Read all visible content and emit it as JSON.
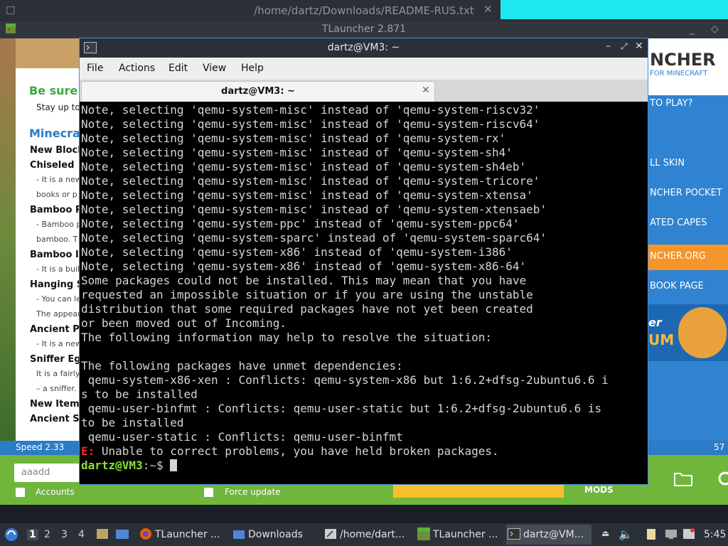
{
  "background_window": {
    "title": "/home/dartz/Downloads/README-RUS.txt"
  },
  "tlauncher": {
    "title": "TLauncher 2.871",
    "news_heading": "Be sure t",
    "news_sub": "Stay up to",
    "news_section": "Minecraft",
    "news_items": [
      {
        "text": "New Blocks",
        "style": "bold"
      },
      {
        "text": "Chiseled",
        "style": "bold"
      },
      {
        "text": "- It is a new",
        "style": "small"
      },
      {
        "text": "books or p",
        "style": "small"
      },
      {
        "text": "Bamboo P",
        "style": "bold"
      },
      {
        "text": "- Bamboo p",
        "style": "small"
      },
      {
        "text": "bamboo. T",
        "style": "small"
      },
      {
        "text": "Bamboo I",
        "style": "bold"
      },
      {
        "text": "- It is a buil",
        "style": "small"
      },
      {
        "text": "Hanging S",
        "style": "bold"
      },
      {
        "text": "- You can le",
        "style": "small"
      },
      {
        "text": "The appear",
        "style": "small"
      },
      {
        "text": "Ancient P",
        "style": "bold"
      },
      {
        "text": "- It is a new",
        "style": "small"
      },
      {
        "text": "Sniffer Eg",
        "style": "bold"
      },
      {
        "text": "It is a fairly",
        "style": "small"
      },
      {
        "text": "– a sniffer.",
        "style": "small"
      },
      {
        "text": "New Items",
        "style": "bold"
      },
      {
        "text": "Ancient S",
        "style": "bold"
      }
    ],
    "logo_text": "NCHER",
    "logo_sub": "FOR MINECRAFT",
    "right_menu": [
      "TO PLAY?",
      "LL SKIN",
      "NCHER POCKET",
      "ATED CAPES",
      "NCHER.ORG",
      "BOOK PAGE"
    ],
    "speed_label": "Speed 2.33",
    "progress_text": "57",
    "username_value": "aaadd",
    "accounts_label": "Accounts",
    "force_update_label": "Force update",
    "mods_label": "MODS",
    "colors": {
      "tl_green": "#6fb63b",
      "tl_blue": "#2f83d0",
      "tl_orange": "#f5952a"
    }
  },
  "terminal": {
    "window_title": "dartz@VM3: ~",
    "menu": [
      "File",
      "Actions",
      "Edit",
      "View",
      "Help"
    ],
    "tab_title": "dartz@VM3: ~",
    "lines": [
      "Note, selecting 'qemu-system-misc' instead of 'qemu-system-riscv32'",
      "Note, selecting 'qemu-system-misc' instead of 'qemu-system-riscv64'",
      "Note, selecting 'qemu-system-misc' instead of 'qemu-system-rx'",
      "Note, selecting 'qemu-system-misc' instead of 'qemu-system-sh4'",
      "Note, selecting 'qemu-system-misc' instead of 'qemu-system-sh4eb'",
      "Note, selecting 'qemu-system-misc' instead of 'qemu-system-tricore'",
      "Note, selecting 'qemu-system-misc' instead of 'qemu-system-xtensa'",
      "Note, selecting 'qemu-system-misc' instead of 'qemu-system-xtensaeb'",
      "Note, selecting 'qemu-system-ppc' instead of 'qemu-system-ppc64'",
      "Note, selecting 'qemu-system-sparc' instead of 'qemu-system-sparc64'",
      "Note, selecting 'qemu-system-x86' instead of 'qemu-system-i386'",
      "Note, selecting 'qemu-system-x86' instead of 'qemu-system-x86-64'",
      "Some packages could not be installed. This may mean that you have",
      "requested an impossible situation or if you are using the unstable",
      "distribution that some required packages have not yet been created",
      "or been moved out of Incoming.",
      "The following information may help to resolve the situation:",
      "",
      "The following packages have unmet dependencies:",
      " qemu-system-x86-xen : Conflicts: qemu-system-x86 but 1:6.2+dfsg-2ubuntu6.6 i",
      "s to be installed",
      " qemu-user-binfmt : Conflicts: qemu-user-static but 1:6.2+dfsg-2ubuntu6.6 is",
      "to be installed",
      " qemu-user-static : Conflicts: qemu-user-binfmt"
    ],
    "error_prefix": "E:",
    "error_message": " Unable to correct problems, you have held broken packages.",
    "prompt_user": "dartz@VM3",
    "prompt_sep": ":",
    "prompt_path": "~",
    "prompt_symbol": "$ ",
    "colors": {
      "background": "#000000",
      "foreground": "#d3d7cf",
      "prompt_user": "#8ae234",
      "prompt_path": "#729fcf",
      "error": "#ef2929"
    }
  },
  "taskbar": {
    "workspaces": [
      "1",
      "2",
      "3",
      "4"
    ],
    "tasks": [
      {
        "label": "TLauncher ...",
        "icon": "firefox-icon"
      },
      {
        "label": "Downloads",
        "icon": "folder-icon"
      },
      {
        "label": "/home/dart...",
        "icon": "text-editor-icon"
      },
      {
        "label": "TLauncher ...",
        "icon": "minecraft-icon"
      },
      {
        "label": "dartz@VM...",
        "icon": "terminal-icon"
      }
    ],
    "clock": "5:45"
  }
}
